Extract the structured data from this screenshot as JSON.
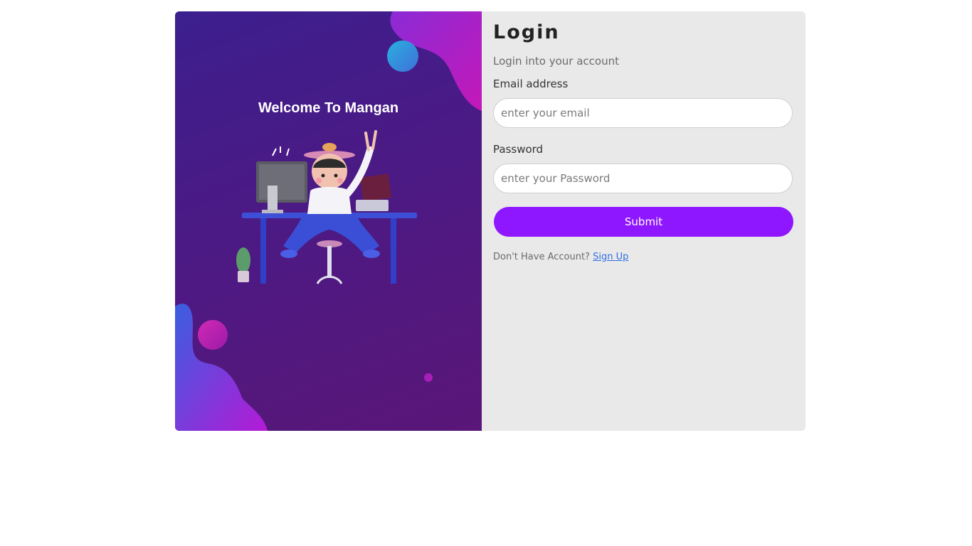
{
  "hero": {
    "welcome": "Welcome To Mangan"
  },
  "form": {
    "title": "Login",
    "subtitle": "Login into your account",
    "email_label": "Email address",
    "email_placeholder": "enter your email",
    "password_label": "Password",
    "password_placeholder": "enter your Password",
    "submit_label": "Submit",
    "no_account_text": "Don't Have Account?",
    "signup_link": "Sign Up"
  },
  "colors": {
    "accent": "#8f17ff",
    "panel_gradient_start": "#3c1f8e",
    "panel_gradient_end": "#5a1678",
    "link": "#2f6fe0",
    "form_background": "#e9e9e9"
  }
}
